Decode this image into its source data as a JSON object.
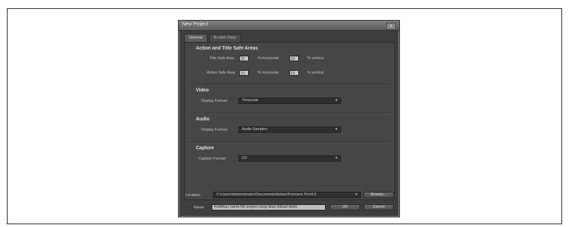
{
  "dialog": {
    "title": "New Project",
    "close_glyph": "x",
    "tabs": [
      {
        "label": "General",
        "active": true
      },
      {
        "label": "Scratch Disks",
        "active": false
      }
    ],
    "safe_areas": {
      "heading": "Action and Title Safe Areas",
      "title_label": "Title Safe Area",
      "title_h": "20",
      "title_h_unit": "% horizontal",
      "title_v": "20",
      "title_v_unit": "% vertical",
      "action_label": "Action Safe Area",
      "action_h": "10",
      "action_h_unit": "% horizontal",
      "action_v": "10",
      "action_v_unit": "% vertical"
    },
    "video": {
      "heading": "Video",
      "label": "Display Format:",
      "value": "Timecode"
    },
    "audio": {
      "heading": "Audio",
      "label": "Display Format:",
      "value": "Audio Samples"
    },
    "capture": {
      "heading": "Capture",
      "label": "Capture Format:",
      "value": "DV"
    },
    "location": {
      "label": "Location:",
      "value": "C:\\Users\\Administrator\\Documents\\Adobe\\Premiere Pro\\4.0",
      "browse_label": "Browse..."
    },
    "name": {
      "label": "Name:",
      "value": "Ketikkan nama file project yang akan dibuat disini"
    },
    "ok_label": "OK",
    "cancel_label": "Cancel",
    "dropdown_arrow": "▼"
  }
}
